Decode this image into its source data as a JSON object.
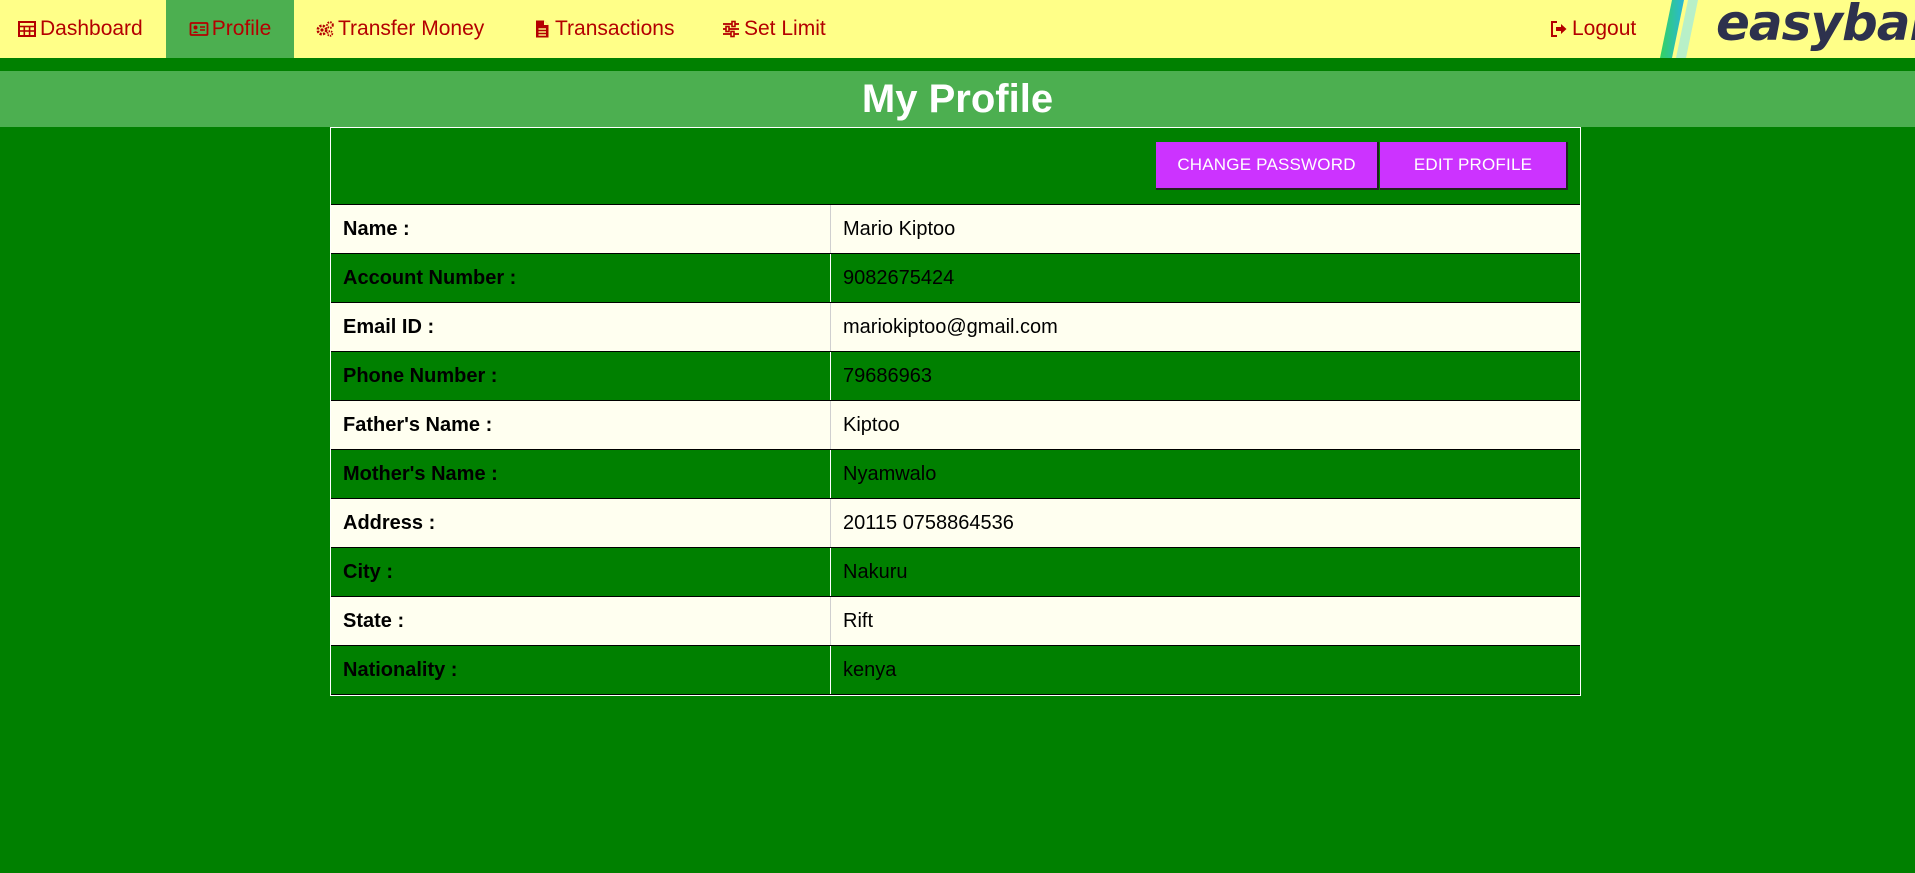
{
  "nav": {
    "items": [
      {
        "label": "Dashboard",
        "icon": "table-icon"
      },
      {
        "label": "Profile",
        "icon": "id-card-icon"
      },
      {
        "label": "Transfer Money",
        "icon": "gears-icon"
      },
      {
        "label": "Transactions",
        "icon": "file-text-icon"
      },
      {
        "label": "Set Limit",
        "icon": "sliders-icon"
      }
    ],
    "logout_label": "Logout",
    "active": "Profile"
  },
  "logo": {
    "text": "easybank"
  },
  "page_title": "My Profile",
  "actions": {
    "change_password": "CHANGE PASSWORD",
    "edit_profile": "EDIT PROFILE"
  },
  "profile": {
    "rows": [
      {
        "label": "Name :",
        "value": "Mario Kiptoo"
      },
      {
        "label": "Account Number :",
        "value": "9082675424"
      },
      {
        "label": "Email ID :",
        "value": "mariokiptoo@gmail.com"
      },
      {
        "label": "Phone Number :",
        "value": "79686963"
      },
      {
        "label": "Father's Name :",
        "value": "Kiptoo"
      },
      {
        "label": "Mother's Name :",
        "value": "Nyamwalo"
      },
      {
        "label": "Address :",
        "value": "20115 0758864536"
      },
      {
        "label": "City :",
        "value": "Nakuru"
      },
      {
        "label": "State :",
        "value": "Rift"
      },
      {
        "label": "Nationality :",
        "value": "kenya"
      }
    ]
  },
  "colors": {
    "nav_bg": "#ffff88",
    "nav_text": "#b40000",
    "active_tab": "#4caf50",
    "page_bg": "#008000",
    "button_bg": "#cc33ff",
    "row_light": "#fffff0"
  }
}
